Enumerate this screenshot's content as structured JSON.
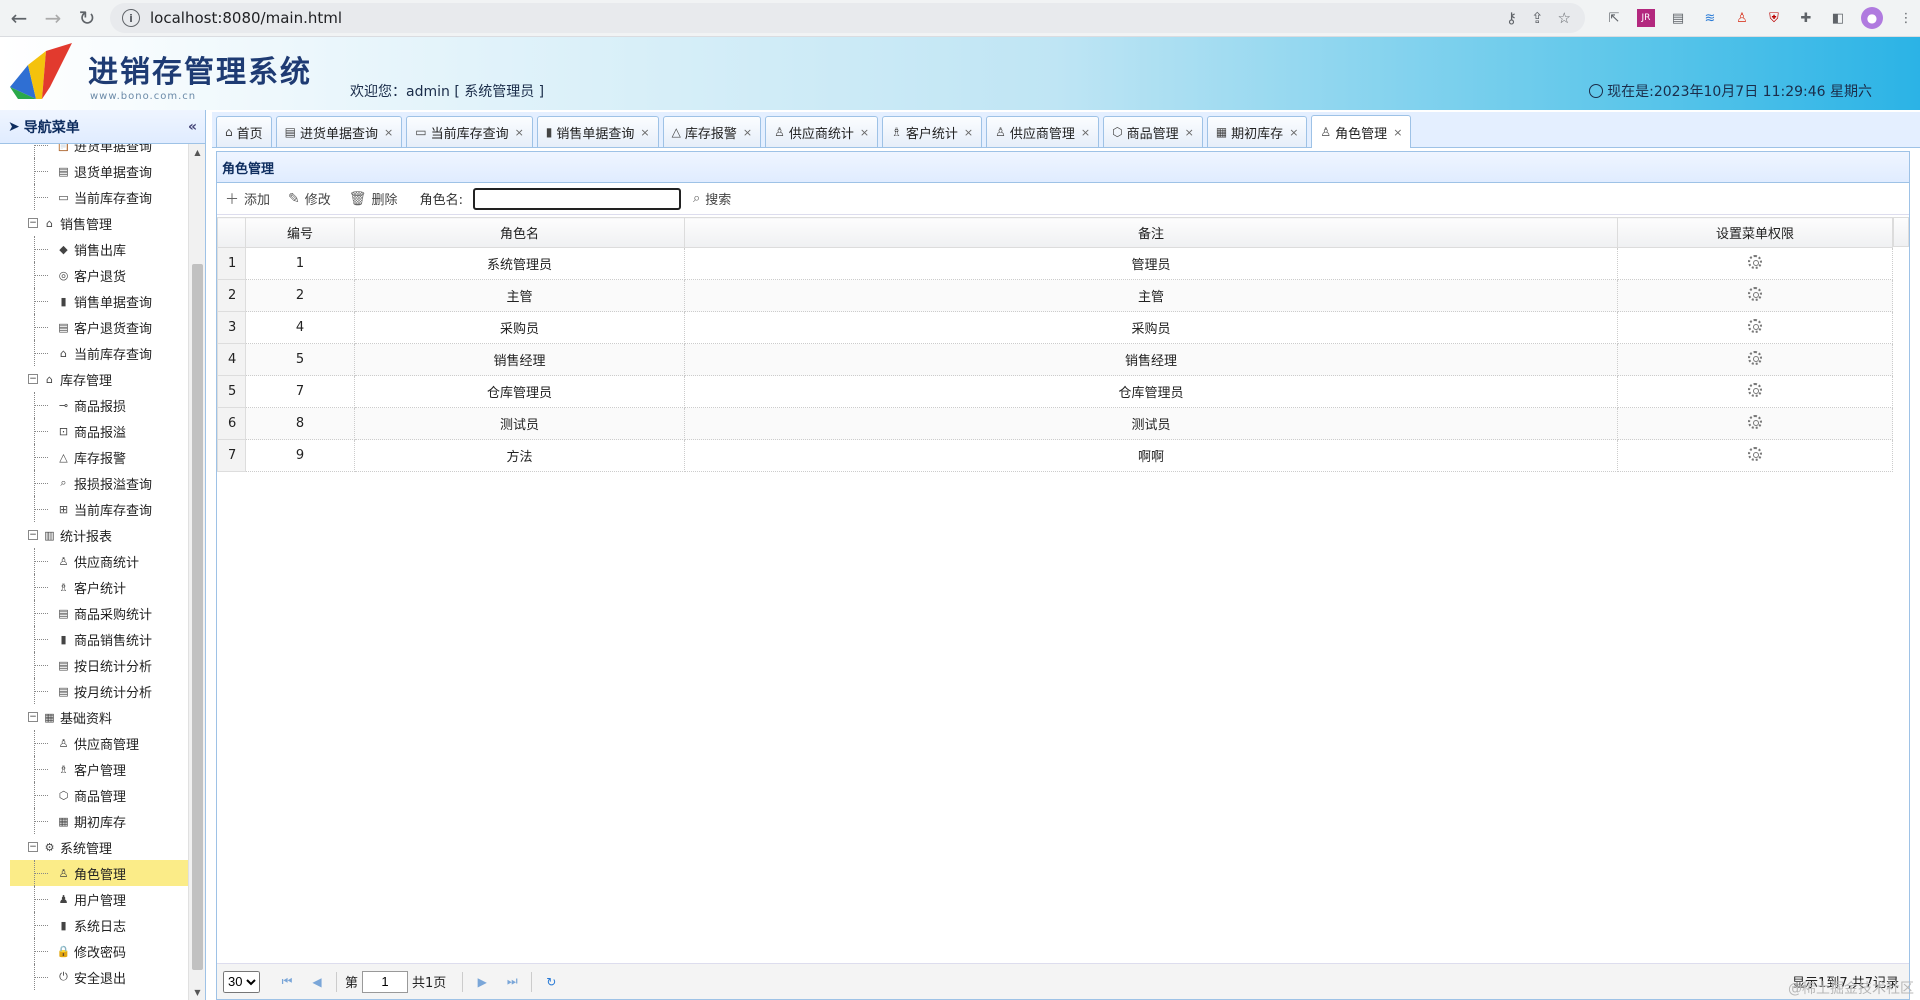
{
  "browser": {
    "url": "localhost:8080/main.html"
  },
  "header": {
    "title": "进销存管理系统",
    "subtitle_url": "www.bono.com.cn",
    "welcome": "欢迎您：admin [ 系统管理员 ]",
    "clock": "现在是:2023年10月7日 11:29:46 星期六"
  },
  "sidebar": {
    "title": "导航菜单",
    "tree": [
      {
        "type": "leaf",
        "label": "进货单据查询",
        "icon": "📋"
      },
      {
        "type": "leaf",
        "label": "退货单据查询",
        "icon": "▤"
      },
      {
        "type": "leaf",
        "label": "当前库存查询",
        "icon": "▭"
      },
      {
        "type": "group",
        "label": "销售管理",
        "icon": "⌂"
      },
      {
        "type": "leaf",
        "label": "销售出库",
        "icon": "◆"
      },
      {
        "type": "leaf",
        "label": "客户退货",
        "icon": "◎"
      },
      {
        "type": "leaf",
        "label": "销售单据查询",
        "icon": "▮"
      },
      {
        "type": "leaf",
        "label": "客户退货查询",
        "icon": "▤"
      },
      {
        "type": "leaf",
        "label": "当前库存查询",
        "icon": "⌂"
      },
      {
        "type": "group",
        "label": "库存管理",
        "icon": "⌂"
      },
      {
        "type": "leaf",
        "label": "商品报损",
        "icon": "⊸"
      },
      {
        "type": "leaf",
        "label": "商品报溢",
        "icon": "⊡"
      },
      {
        "type": "leaf",
        "label": "库存报警",
        "icon": "△"
      },
      {
        "type": "leaf",
        "label": "报损报溢查询",
        "icon": "⌕"
      },
      {
        "type": "leaf",
        "label": "当前库存查询",
        "icon": "⊞"
      },
      {
        "type": "group",
        "label": "统计报表",
        "icon": "▥"
      },
      {
        "type": "leaf",
        "label": "供应商统计",
        "icon": "♙"
      },
      {
        "type": "leaf",
        "label": "客户统计",
        "icon": "♗"
      },
      {
        "type": "leaf",
        "label": "商品采购统计",
        "icon": "▤"
      },
      {
        "type": "leaf",
        "label": "商品销售统计",
        "icon": "▮"
      },
      {
        "type": "leaf",
        "label": "按日统计分析",
        "icon": "▤"
      },
      {
        "type": "leaf",
        "label": "按月统计分析",
        "icon": "▤"
      },
      {
        "type": "group",
        "label": "基础资料",
        "icon": "▦"
      },
      {
        "type": "leaf",
        "label": "供应商管理",
        "icon": "♙"
      },
      {
        "type": "leaf",
        "label": "客户管理",
        "icon": "♗"
      },
      {
        "type": "leaf",
        "label": "商品管理",
        "icon": "⬡"
      },
      {
        "type": "leaf",
        "label": "期初库存",
        "icon": "▦"
      },
      {
        "type": "group",
        "label": "系统管理",
        "icon": "⚙"
      },
      {
        "type": "leaf",
        "label": "角色管理",
        "icon": "♙",
        "selected": true
      },
      {
        "type": "leaf",
        "label": "用户管理",
        "icon": "♟"
      },
      {
        "type": "leaf",
        "label": "系统日志",
        "icon": "▮"
      },
      {
        "type": "leaf",
        "label": "修改密码",
        "icon": "🔒"
      },
      {
        "type": "leaf",
        "label": "安全退出",
        "icon": "⏻"
      }
    ]
  },
  "tabs": [
    {
      "label": "首页",
      "icon": "⌂",
      "closable": false
    },
    {
      "label": "进货单据查询",
      "icon": "▤",
      "closable": true
    },
    {
      "label": "当前库存查询",
      "icon": "▭",
      "closable": true
    },
    {
      "label": "销售单据查询",
      "icon": "▮",
      "closable": true
    },
    {
      "label": "库存报警",
      "icon": "△",
      "closable": true
    },
    {
      "label": "供应商统计",
      "icon": "♙",
      "closable": true
    },
    {
      "label": "客户统计",
      "icon": "♗",
      "closable": true
    },
    {
      "label": "供应商管理",
      "icon": "♙",
      "closable": true
    },
    {
      "label": "商品管理",
      "icon": "⬡",
      "closable": true
    },
    {
      "label": "期初库存",
      "icon": "▦",
      "closable": true
    },
    {
      "label": "角色管理",
      "icon": "♙",
      "closable": true,
      "active": true
    }
  ],
  "panel": {
    "title": "角色管理",
    "toolbar": {
      "add": "添加",
      "edit": "修改",
      "delete": "删除",
      "search_label": "角色名:",
      "search_value": "",
      "search_btn": "搜索"
    },
    "columns": [
      "编号",
      "角色名",
      "备注",
      "设置菜单权限"
    ],
    "rows": [
      {
        "n": "1",
        "id": "1",
        "name": "系统管理员",
        "remark": "管理员"
      },
      {
        "n": "2",
        "id": "2",
        "name": "主管",
        "remark": "主管"
      },
      {
        "n": "3",
        "id": "4",
        "name": "采购员",
        "remark": "采购员"
      },
      {
        "n": "4",
        "id": "5",
        "name": "销售经理",
        "remark": "销售经理"
      },
      {
        "n": "5",
        "id": "7",
        "name": "仓库管理员",
        "remark": "仓库管理员"
      },
      {
        "n": "6",
        "id": "8",
        "name": "测试员",
        "remark": "测试员"
      },
      {
        "n": "7",
        "id": "9",
        "name": "方法",
        "remark": "啊啊"
      }
    ],
    "pager": {
      "page_size": "30",
      "page_prefix": "第",
      "page": "1",
      "page_suffix": "共1页",
      "display": "显示1到7,共7记录"
    }
  },
  "watermark": "@稀土掘金技术社区"
}
